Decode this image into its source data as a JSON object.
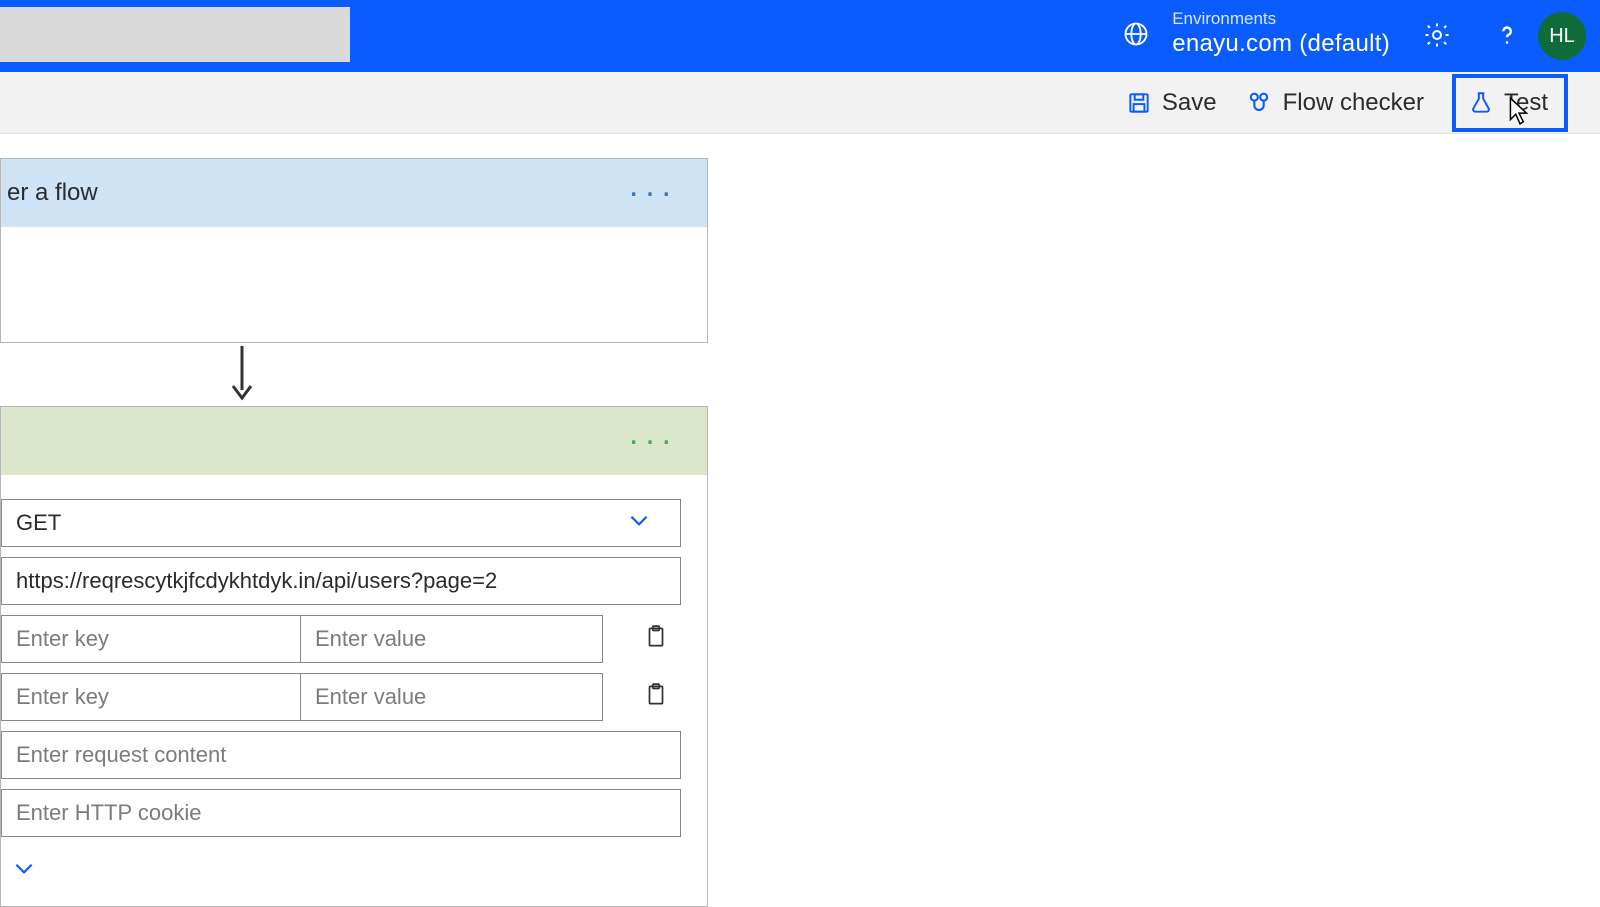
{
  "header": {
    "env_label": "Environments",
    "env_name": "enayu.com (default)",
    "avatar_initials": "HL"
  },
  "action_bar": {
    "save_label": "Save",
    "flow_checker_label": "Flow checker",
    "test_label": "Test"
  },
  "flow": {
    "trigger": {
      "title_fragment": "er a flow"
    },
    "http": {
      "method": "GET",
      "url": "https://reqrescytkjfcdykhtdyk.in/api/users?page=2",
      "key_placeholder": "Enter key",
      "value_placeholder": "Enter value",
      "body_placeholder": "Enter request content",
      "cookie_placeholder": "Enter HTTP cookie"
    }
  }
}
